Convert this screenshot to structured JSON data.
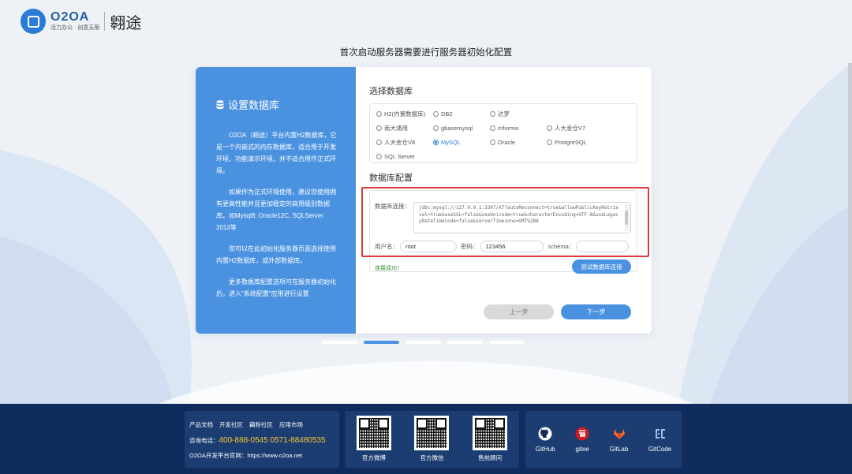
{
  "header": {
    "logo_name": "O2OA",
    "logo_sub": "活力办公 · 创意无限",
    "brand": "翱途"
  },
  "page_title": "首次启动服务器需要进行服务器初始化配置",
  "left_panel": {
    "title": "设置数据库",
    "paragraphs": [
      "O2OA（翱途）平台内置H2数据库，它是一个内嵌式的内存数据库，适合用于开发环境、功能演示环境，并不适合用作正式环境。",
      "如果作为正式环境使用，建议您使用拥有更高性能并且更加稳定的商用级别数据库。如Mysql8, Oracle12C, SQLServer 2012等",
      "您可以在此初始化服务器页面选择使用内置H2数据库，或外部数据库。",
      "更多数据库配置选项可在服务器初始化后，进入\"系统配置\"应用进行设置"
    ]
  },
  "db_select": {
    "title": "选择数据库",
    "options": [
      "H2(内置数据库)",
      "DB2",
      "达梦",
      "",
      "南大通用",
      "gbasemysql",
      "Informix",
      "人大金仓V7",
      "人大金仓V8",
      "MySQL",
      "Oracle",
      "PostgreSQL",
      "SQL Server"
    ],
    "selected": "MySQL"
  },
  "db_config": {
    "title": "数据库配置",
    "conn_label": "数据库连接：",
    "conn_value": "jdbc:mysql://127.0.0.1:3307/X7?autoReconnect=true&allowPublicKeyRetrieval=true&useSSL=false&useUnicode=true&characterEncoding=UTF-8&useLegacyDatetimeCode=false&serverTimezone=GMT%2B8",
    "user_label": "用户名：",
    "user_value": "root",
    "pwd_label": "密码：",
    "pwd_value": "123456",
    "schema_label": "schema：",
    "schema_value": "",
    "success_text": "连接成功！",
    "test_button": "测试数据库连接"
  },
  "nav": {
    "prev": "上一步",
    "next": "下一步",
    "steps": 5,
    "active_step": 2
  },
  "footer": {
    "links": [
      "产品文档",
      "开发社区",
      "藕粉社区",
      "应用市场"
    ],
    "phone_label": "咨询电话：",
    "phone": "400-888-0545 0571-88480535",
    "site": "O2OA开发平台官网：https://www.o2oa.net",
    "qr_labels": [
      "官方微博",
      "官方微信",
      "售前顾问"
    ],
    "social": [
      "GitHub",
      "gitee",
      "GitLab",
      "GitCode"
    ]
  },
  "colors": {
    "accent": "#4a92e0",
    "footer_bg": "#0f2c5c",
    "highlight": "#e03a3a",
    "success": "#2e8b2e",
    "phone": "#f7c830"
  }
}
